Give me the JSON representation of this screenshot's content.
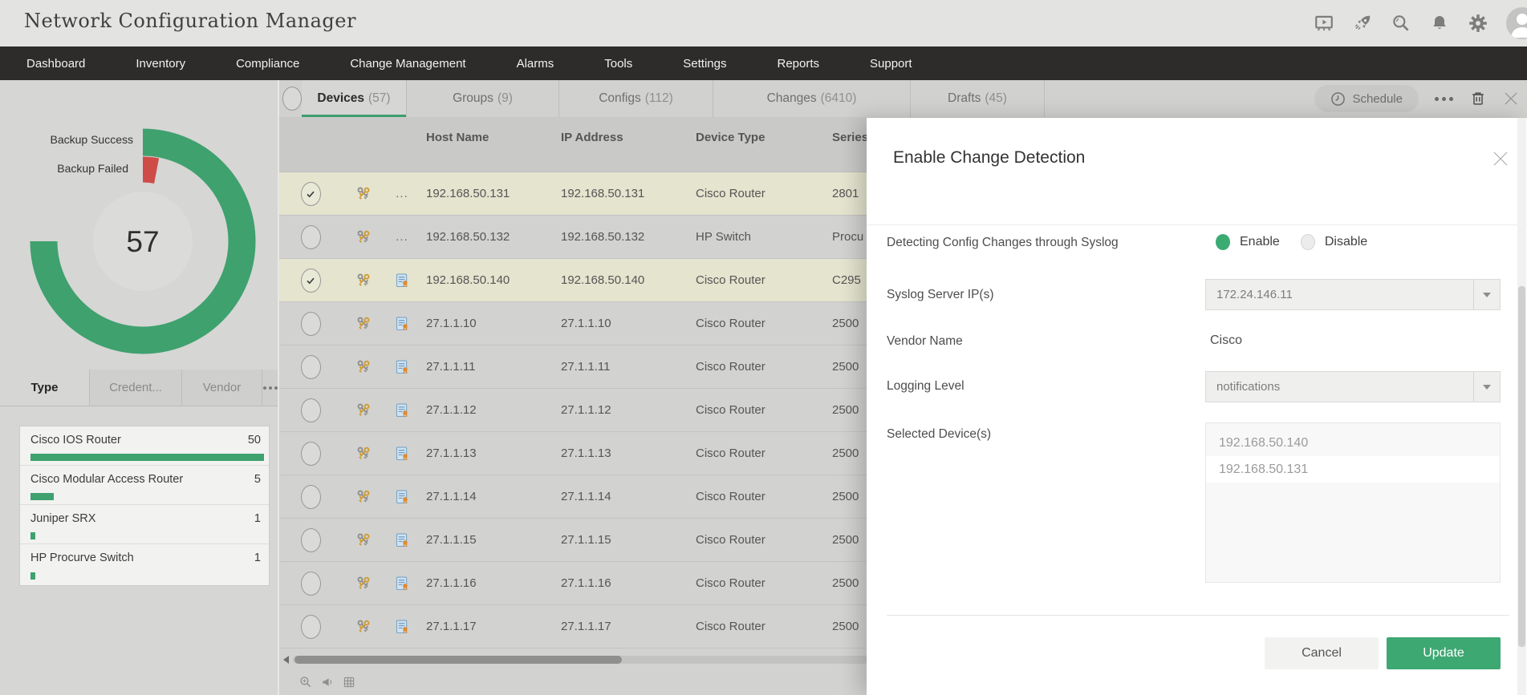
{
  "app": {
    "title": "Network Configuration Manager"
  },
  "nav": {
    "items": [
      "Dashboard",
      "Inventory",
      "Compliance",
      "Change Management",
      "Alarms",
      "Tools",
      "Settings",
      "Reports",
      "Support"
    ]
  },
  "header_icons": [
    "presentation-icon",
    "rocket-icon",
    "search-icon",
    "bell-icon",
    "gear-icon",
    "avatar"
  ],
  "colors": {
    "accent_green": "#3fa16e",
    "failed_red": "#cf4b48",
    "selected_row": "#e4e4cf",
    "navbar": "#2d2c2b",
    "update_button": "#3ea873"
  },
  "chart_data": [
    {
      "id": "backup-status-donut",
      "type": "donut",
      "center_total": "57",
      "legend_position": "left",
      "series": [
        {
          "label": "Backup Success",
          "color": "#3fa16e",
          "arc_degrees": 270
        },
        {
          "label": "Backup Failed",
          "color": "#cf4b48",
          "arc_degrees": 11
        }
      ]
    },
    {
      "id": "device-type-bars",
      "type": "bar",
      "max": 50,
      "bar_color": "#3fa16e",
      "items": [
        {
          "label": "Cisco IOS Router",
          "value": 50
        },
        {
          "label": "Cisco Modular Access Router",
          "value": 5
        },
        {
          "label": "Juniper SRX",
          "value": 1
        },
        {
          "label": "HP Procurve Switch",
          "value": 1
        }
      ]
    }
  ],
  "sidebar": {
    "tabs": {
      "items": [
        "Type",
        "Credent...",
        "Vendor"
      ],
      "active": "Type"
    }
  },
  "main": {
    "active_tab": 0,
    "tabs": [
      {
        "label": "Devices",
        "count": "(57)"
      },
      {
        "label": "Groups",
        "count": "(9)"
      },
      {
        "label": "Configs",
        "count": "(112)"
      },
      {
        "label": "Changes",
        "count": "(6410)"
      },
      {
        "label": "Drafts",
        "count": "(45)"
      }
    ],
    "toolbar": {
      "schedule_label": "Schedule"
    },
    "table": {
      "columns": [
        "Host Name",
        "IP Address",
        "Device Type",
        "Series"
      ],
      "more_indicator": "...",
      "rows": [
        {
          "checked": true,
          "selected": true,
          "extra": "dots",
          "host": "192.168.50.131",
          "ip": "192.168.50.131",
          "type": "Cisco Router",
          "series": "2801"
        },
        {
          "checked": false,
          "selected": false,
          "extra": "dots",
          "host": "192.168.50.132",
          "ip": "192.168.50.132",
          "type": "HP Switch",
          "series": "Procu"
        },
        {
          "checked": true,
          "selected": true,
          "extra": "doc",
          "host": "192.168.50.140",
          "ip": "192.168.50.140",
          "type": "Cisco Router",
          "series": "C295"
        },
        {
          "checked": false,
          "selected": false,
          "extra": "doc",
          "host": "27.1.1.10",
          "ip": "27.1.1.10",
          "type": "Cisco Router",
          "series": "2500"
        },
        {
          "checked": false,
          "selected": false,
          "extra": "doc",
          "host": "27.1.1.11",
          "ip": "27.1.1.11",
          "type": "Cisco Router",
          "series": "2500"
        },
        {
          "checked": false,
          "selected": false,
          "extra": "doc",
          "host": "27.1.1.12",
          "ip": "27.1.1.12",
          "type": "Cisco Router",
          "series": "2500"
        },
        {
          "checked": false,
          "selected": false,
          "extra": "doc",
          "host": "27.1.1.13",
          "ip": "27.1.1.13",
          "type": "Cisco Router",
          "series": "2500"
        },
        {
          "checked": false,
          "selected": false,
          "extra": "doc",
          "host": "27.1.1.14",
          "ip": "27.1.1.14",
          "type": "Cisco Router",
          "series": "2500"
        },
        {
          "checked": false,
          "selected": false,
          "extra": "doc",
          "host": "27.1.1.15",
          "ip": "27.1.1.15",
          "type": "Cisco Router",
          "series": "2500"
        },
        {
          "checked": false,
          "selected": false,
          "extra": "doc",
          "host": "27.1.1.16",
          "ip": "27.1.1.16",
          "type": "Cisco Router",
          "series": "2500"
        },
        {
          "checked": false,
          "selected": false,
          "extra": "doc",
          "host": "27.1.1.17",
          "ip": "27.1.1.17",
          "type": "Cisco Router",
          "series": "2500"
        }
      ]
    }
  },
  "modal": {
    "title": "Enable Change Detection",
    "fields": {
      "syslog_detection": {
        "label": "Detecting Config Changes through Syslog",
        "options": [
          "Enable",
          "Disable"
        ],
        "selected": "Enable"
      },
      "syslog_server": {
        "label": "Syslog Server IP(s)",
        "value": "172.24.146.11"
      },
      "vendor": {
        "label": "Vendor Name",
        "value": "Cisco"
      },
      "logging_level": {
        "label": "Logging Level",
        "value": "notifications"
      },
      "selected_devices": {
        "label": "Selected Device(s)",
        "items": [
          "192.168.50.140",
          "192.168.50.131"
        ]
      }
    },
    "buttons": {
      "cancel": "Cancel",
      "update": "Update"
    }
  }
}
